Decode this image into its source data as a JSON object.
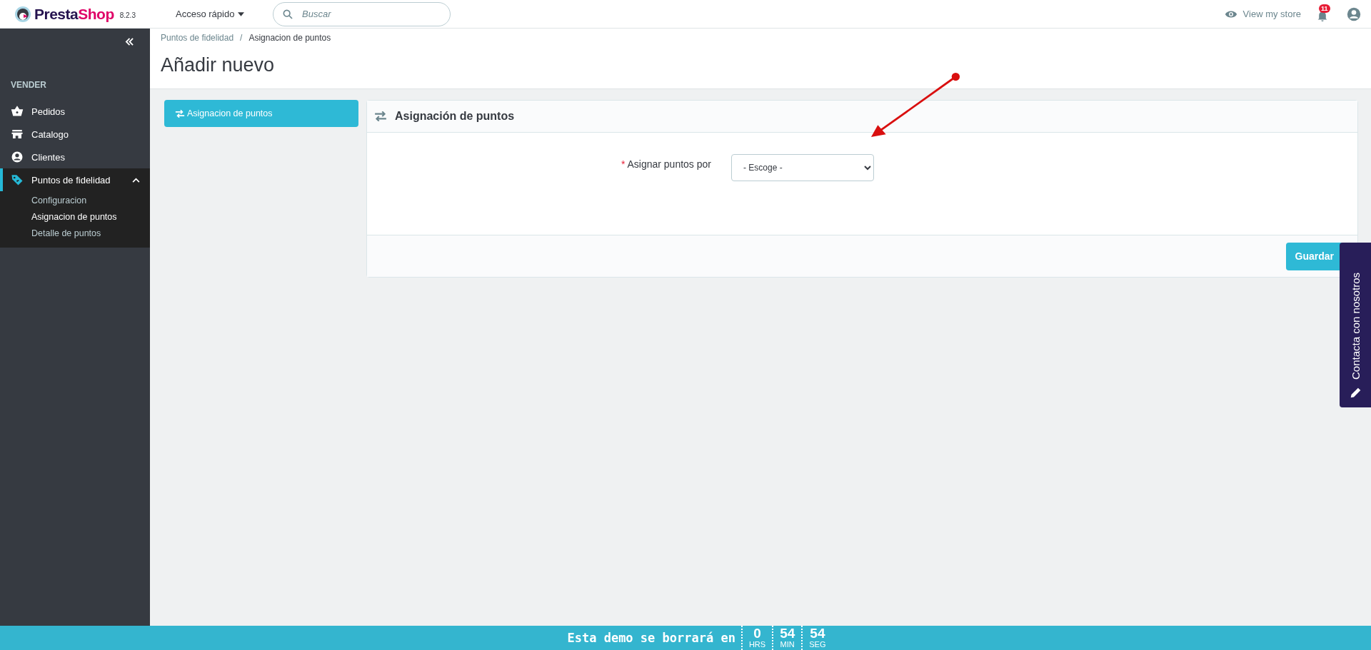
{
  "topbar": {
    "logo": {
      "first": "Presta",
      "second": "Shop"
    },
    "version": "8.2.3",
    "quick_access": "Acceso rápido",
    "search": {
      "placeholder": "Buscar"
    },
    "view_store": "View my store",
    "notifications": "11"
  },
  "sidebar": {
    "section": "VENDER",
    "items": [
      {
        "label": "Pedidos",
        "selected": false
      },
      {
        "label": "Catalogo",
        "selected": false
      },
      {
        "label": "Clientes",
        "selected": false
      },
      {
        "label": "Puntos de fidelidad",
        "selected": true,
        "expanded": true,
        "children": [
          {
            "label": "Configuracion",
            "selected": false
          },
          {
            "label": "Asignacion de puntos",
            "selected": true
          },
          {
            "label": "Detalle de puntos",
            "selected": false
          }
        ]
      }
    ]
  },
  "breadcrumb": {
    "items": [
      "Puntos de fidelidad",
      "Asignacion de puntos"
    ],
    "separator": "/"
  },
  "page_title": "Añadir nuevo",
  "tabs": [
    {
      "label": "Asignacion de puntos",
      "selected": true
    }
  ],
  "panel": {
    "title": "Asignación de puntos",
    "fields": [
      {
        "label": "Asignar puntos por",
        "required": true,
        "required_mark": "*",
        "value": "- Escoge -"
      }
    ],
    "button": "Guardar"
  },
  "contact_tab": "Contacta con nosotros",
  "demo_bar": {
    "text": "Esta demo se borrará en",
    "units": [
      {
        "value": "0",
        "label": "HRS"
      },
      {
        "value": "54",
        "label": "MIN"
      },
      {
        "value": "54",
        "label": "SEG"
      }
    ]
  }
}
